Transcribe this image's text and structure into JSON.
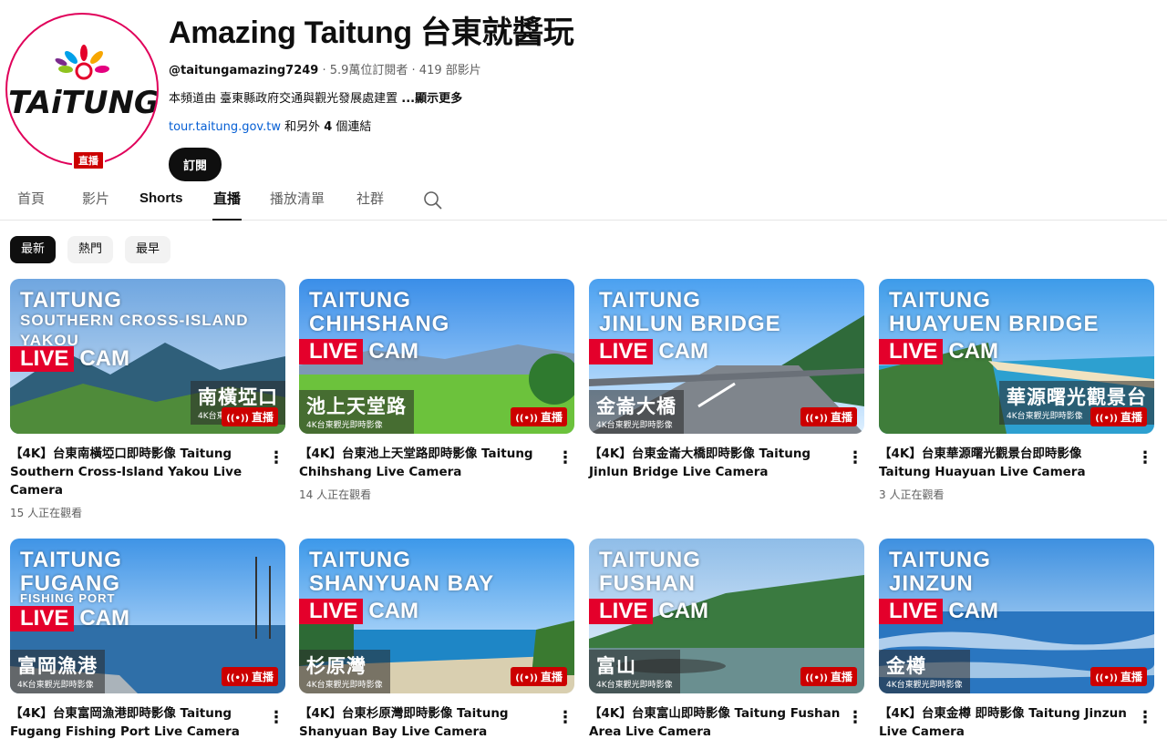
{
  "channel": {
    "title": "Amazing Taitung 台東就醬玩",
    "handle": "@taitungamazing7249",
    "stats": " · 5.9萬位訂閱者 · 419 部影片",
    "description": "本頻道由 臺東縣政府交通與觀光發展處建置 ",
    "description_more": "...顯示更多",
    "link_url": "tour.taitung.gov.tw",
    "link_others_prefix": " 和另外 ",
    "link_others_count": "4",
    "link_others_suffix": " 個連結",
    "subscribe_label": "訂閱",
    "avatar_live_badge": "直播",
    "logo_text": "TAiTUNG"
  },
  "tabs": [
    {
      "label": "首頁"
    },
    {
      "label": "影片"
    },
    {
      "label": "Shorts"
    },
    {
      "label": "直播"
    },
    {
      "label": "播放清單"
    },
    {
      "label": "社群"
    }
  ],
  "search_icon": "search-icon",
  "chips": [
    {
      "label": "最新"
    },
    {
      "label": "熱門"
    },
    {
      "label": "最早"
    }
  ],
  "videos": [
    {
      "thumb_title_lines": [
        "TAITUNG",
        "SOUTHERN CROSS-ISLAND",
        "YAKOU"
      ],
      "thumb_live": "LIVE",
      "thumb_cam": "CAM",
      "thumb_cn": "南橫埡口",
      "thumb_cn_sub": "4K台東觀光即時影像",
      "live_chip": "直播",
      "title": "【4K】台東南橫埡口即時影像 Taitung Southern Cross-Island Yakou Live Camera",
      "meta": "15 人正在觀看"
    },
    {
      "thumb_title_lines": [
        "TAITUNG",
        "CHIHSHANG"
      ],
      "thumb_live": "LIVE",
      "thumb_cam": "CAM",
      "thumb_cn": "池上天堂路",
      "thumb_cn_sub": "4K台東觀光即時影像",
      "live_chip": "直播",
      "title": "【4K】台東池上天堂路即時影像 Taitung Chihshang Live Camera",
      "meta": "14 人正在觀看"
    },
    {
      "thumb_title_lines": [
        "TAITUNG",
        "JINLUN BRIDGE"
      ],
      "thumb_live": "LIVE",
      "thumb_cam": "CAM",
      "thumb_cn": "金崙大橋",
      "thumb_cn_sub": "4K台東觀光即時影像",
      "live_chip": "直播",
      "title": "【4K】台東金崙大橋即時影像 Taitung Jinlun Bridge Live Camera",
      "meta": ""
    },
    {
      "thumb_title_lines": [
        "TAITUNG",
        "HUAYUEN BRIDGE"
      ],
      "thumb_live": "LIVE",
      "thumb_cam": "CAM",
      "thumb_cn": "華源曙光觀景台",
      "thumb_cn_sub": "4K台東觀光即時影像",
      "live_chip": "直播",
      "title": "【4K】台東華源曙光觀景台即時影像 Taitung Huayuan Live Camera",
      "meta": "3 人正在觀看"
    },
    {
      "thumb_title_lines": [
        "TAITUNG",
        "FUGANG",
        "FISHING PORT"
      ],
      "thumb_live": "LIVE",
      "thumb_cam": "CAM",
      "thumb_cn": "富岡漁港",
      "thumb_cn_sub": "4K台東觀光即時影像",
      "live_chip": "直播",
      "title": "【4K】台東富岡漁港即時影像 Taitung Fugang Fishing Port Live Camera",
      "meta": ""
    },
    {
      "thumb_title_lines": [
        "TAITUNG",
        "SHANYUAN BAY"
      ],
      "thumb_live": "LIVE",
      "thumb_cam": "CAM",
      "thumb_cn": "杉原灣",
      "thumb_cn_sub": "4K台東觀光即時影像",
      "live_chip": "直播",
      "title": "【4K】台東杉原灣即時影像 Taitung Shanyuan Bay Live Camera",
      "meta": ""
    },
    {
      "thumb_title_lines": [
        "TAITUNG",
        "FUSHAN"
      ],
      "thumb_live": "LIVE",
      "thumb_cam": "CAM",
      "thumb_cn": "富山",
      "thumb_cn_sub": "4K台東觀光即時影像",
      "live_chip": "直播",
      "title": "【4K】台東富山即時影像 Taitung Fushan Area Live Camera",
      "meta": ""
    },
    {
      "thumb_title_lines": [
        "TAITUNG",
        "JINZUN"
      ],
      "thumb_live": "LIVE",
      "thumb_cam": "CAM",
      "thumb_cn": "金樽",
      "thumb_cn_sub": "4K台東觀光即時影像",
      "live_chip": "直播",
      "title": "【4K】台東金樽 即時影像 Taitung Jinzun Live Camera",
      "meta": ""
    }
  ],
  "colors": {
    "accent_red": "#e4002b",
    "live_red": "#cc0000",
    "link_blue": "#065fd4"
  }
}
